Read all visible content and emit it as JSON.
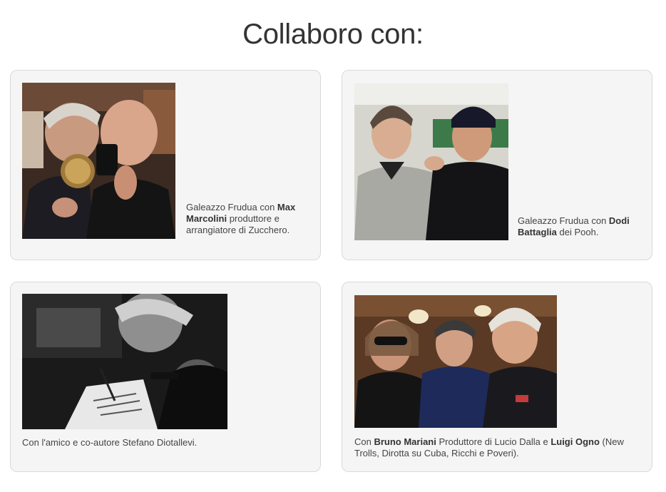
{
  "heading": "Collaboro con:",
  "cards": [
    {
      "caption": {
        "pre": "Galeazzo Frudua con ",
        "bold1": "Max Marcolini",
        "post": " produttore e arrangiatore di Zucchero."
      }
    },
    {
      "caption": {
        "pre": "Galeazzo Frudua con ",
        "bold1": "Dodi Battaglia",
        "post": " dei Pooh."
      }
    },
    {
      "caption": {
        "pre": "Con l'amico e co-autore Stefano Diotallevi.",
        "bold1": "",
        "post": ""
      }
    },
    {
      "caption": {
        "pre": "Con ",
        "bold1": "Bruno Mariani",
        "mid": " Produttore di Lucio Dalla e ",
        "bold2": "Luigi Ogno",
        "post": " (New Trolls, Dirotta su Cuba, Ricchi e Poveri)."
      }
    }
  ]
}
